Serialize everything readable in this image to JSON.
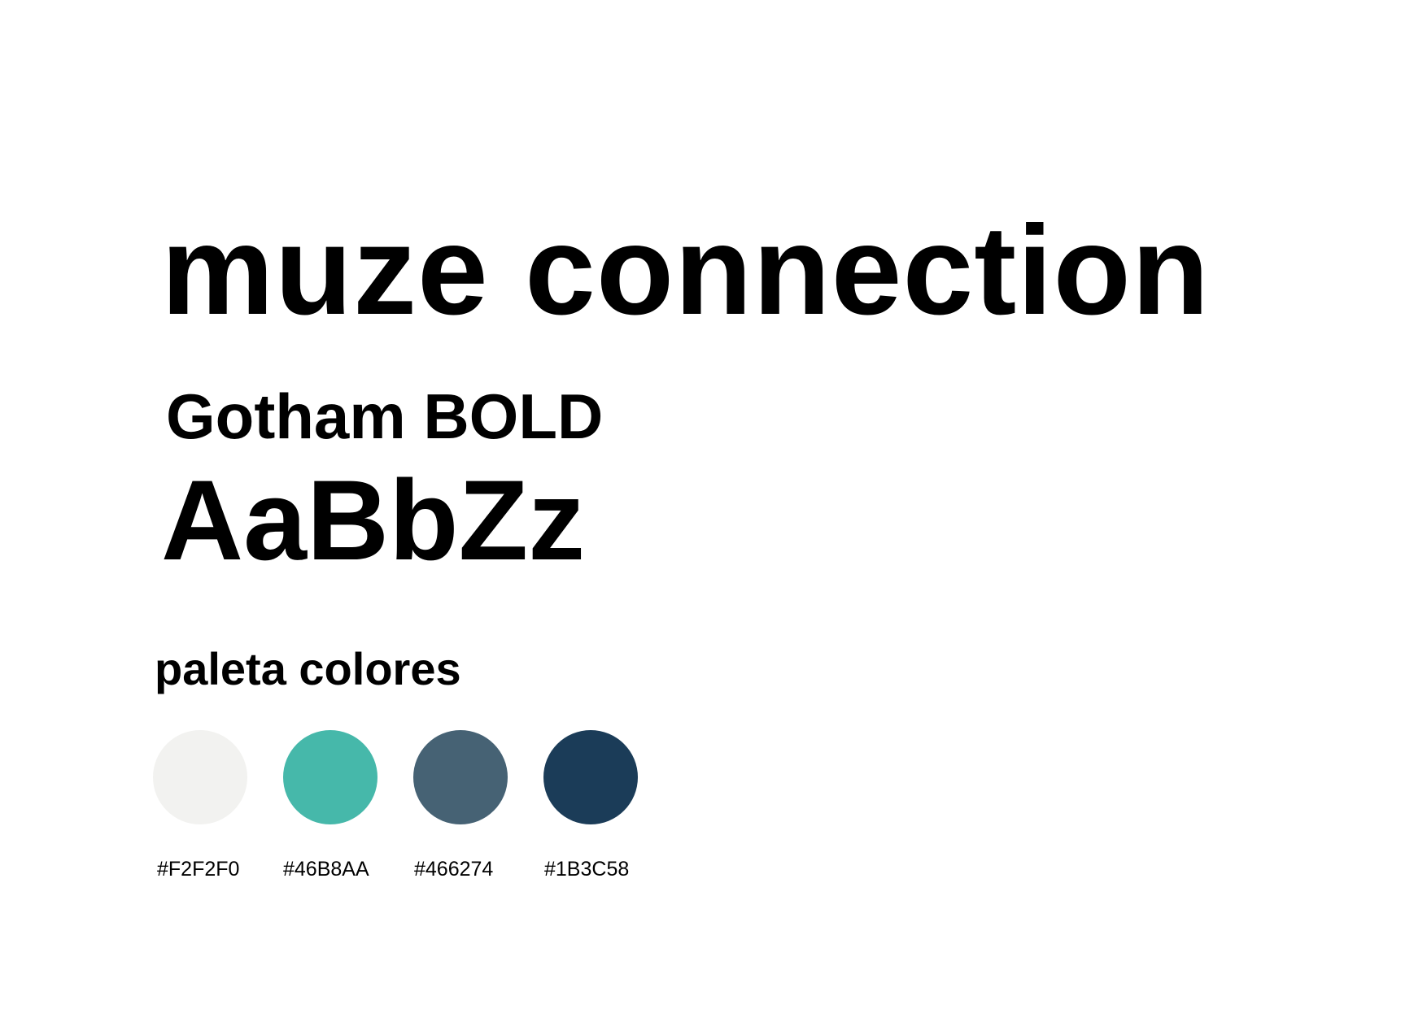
{
  "brand": {
    "name": "muze connection"
  },
  "typography": {
    "font_name": "Gotham BOLD",
    "specimen": "AaBbZz"
  },
  "palette": {
    "heading": "paleta colores",
    "colors": [
      {
        "label": "#F2F2F0",
        "hex": "#F2F2F0"
      },
      {
        "label": "#46B8AA",
        "hex": "#46B8AA"
      },
      {
        "label": "#466274",
        "hex": "#466274"
      },
      {
        "label": "#1B3C58",
        "hex": "#1B3C58"
      }
    ]
  }
}
